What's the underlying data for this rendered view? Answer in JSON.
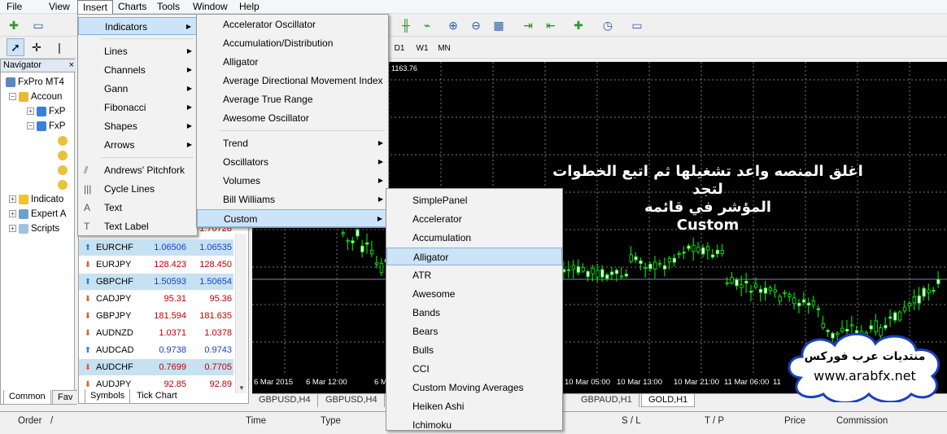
{
  "menubar": {
    "items": [
      "File",
      "View",
      "Insert",
      "Charts",
      "Tools",
      "Window",
      "Help"
    ],
    "active": "Insert"
  },
  "toolbar": {
    "timeframes": [
      "D1",
      "W1",
      "MN"
    ]
  },
  "navigator": {
    "title": "Navigator",
    "tree": [
      {
        "label": "FxPro MT4",
        "icon": "terminal-icon"
      },
      {
        "label": "Accoun",
        "icon": "accounts-icon"
      },
      {
        "label": "FxP",
        "icon": "server-icon"
      },
      {
        "label": "FxP",
        "icon": "server-icon"
      },
      {
        "label": "",
        "icon": "user-icon"
      },
      {
        "label": "",
        "icon": "user-icon"
      },
      {
        "label": "",
        "icon": "user-icon"
      },
      {
        "label": "",
        "icon": "user-icon"
      },
      {
        "label": "Indicato",
        "icon": "indicators-icon"
      },
      {
        "label": "Expert A",
        "icon": "expert-icon"
      },
      {
        "label": "Scripts",
        "icon": "scripts-icon"
      }
    ],
    "tabs": [
      "Common",
      "Fav"
    ]
  },
  "market_watch": {
    "partial_top": "1.70728",
    "rows": [
      {
        "symbol": "EURCHF",
        "bid": "1.06506",
        "ask": "1.06535",
        "dir": "up",
        "highlight": true
      },
      {
        "symbol": "EURJPY",
        "bid": "128.423",
        "ask": "128.450",
        "dir": "down",
        "highlight": false
      },
      {
        "symbol": "GBPCHF",
        "bid": "1.50593",
        "ask": "1.50654",
        "dir": "up",
        "highlight": true
      },
      {
        "symbol": "CADJPY",
        "bid": "95.31",
        "ask": "95.36",
        "dir": "down",
        "highlight": false
      },
      {
        "symbol": "GBPJPY",
        "bid": "181.594",
        "ask": "181.635",
        "dir": "down",
        "highlight": false
      },
      {
        "symbol": "AUDNZD",
        "bid": "1.0371",
        "ask": "1.0378",
        "dir": "down",
        "highlight": false
      },
      {
        "symbol": "AUDCAD",
        "bid": "0.9738",
        "ask": "0.9743",
        "dir": "up",
        "highlight": false
      },
      {
        "symbol": "AUDCHF",
        "bid": "0.7699",
        "ask": "0.7705",
        "dir": "down",
        "highlight": true
      },
      {
        "symbol": "AUDJPY",
        "bid": "92.85",
        "ask": "92.89",
        "dir": "down",
        "highlight": false
      }
    ],
    "tabs": [
      "Symbols",
      "Tick Chart"
    ]
  },
  "chart": {
    "price_label": "1163.76",
    "time_labels": [
      "6 Mar 2015",
      "6 Mar 12:00",
      "6 Mar 20",
      "10 Mar 05:00",
      "10 Mar 13:00",
      "10 Mar 21:00",
      "11 Mar 06:00",
      "11"
    ],
    "bull_color": "#00ff00",
    "bear_color": "#ffffff",
    "annotation_line1": "اغلق المنصه واعد تشغيلها ثم اتبع الخطوات لتجد",
    "annotation_line2": "المؤشر في قائمه",
    "annotation_line3": "Custom",
    "tabs": [
      "GBPUSD,H4",
      "GBPUSD,H4",
      "GBPAUD,H1",
      "GOLD,H1"
    ],
    "active_tab": "GOLD,H1"
  },
  "watermark": {
    "line1": "منتديات عرب فوركس",
    "line2": "www.arabfx.net"
  },
  "insert_menu": {
    "items": [
      {
        "label": "Indicators",
        "sub": true,
        "icon": ""
      },
      {
        "label": "Lines",
        "sub": true,
        "icon": ""
      },
      {
        "label": "Channels",
        "sub": true,
        "icon": ""
      },
      {
        "label": "Gann",
        "sub": true,
        "icon": ""
      },
      {
        "label": "Fibonacci",
        "sub": true,
        "icon": ""
      },
      {
        "label": "Shapes",
        "sub": true,
        "icon": ""
      },
      {
        "label": "Arrows",
        "sub": true,
        "icon": ""
      },
      {
        "label": "Andrews' Pitchfork",
        "sub": false,
        "icon": "⫽"
      },
      {
        "label": "Cycle Lines",
        "sub": false,
        "icon": "|||"
      },
      {
        "label": "Text",
        "sub": false,
        "icon": "A"
      },
      {
        "label": "Text Label",
        "sub": false,
        "icon": "T"
      }
    ]
  },
  "indicators_menu": {
    "items": [
      {
        "label": "Accelerator Oscillator",
        "sub": false
      },
      {
        "label": "Accumulation/Distribution",
        "sub": false
      },
      {
        "label": "Alligator",
        "sub": false
      },
      {
        "label": "Average Directional Movement Index",
        "sub": false
      },
      {
        "label": "Average True Range",
        "sub": false
      },
      {
        "label": "Awesome Oscillator",
        "sub": false
      },
      {
        "label": "Trend",
        "sub": true
      },
      {
        "label": "Oscillators",
        "sub": true
      },
      {
        "label": "Volumes",
        "sub": true
      },
      {
        "label": "Bill Williams",
        "sub": true
      },
      {
        "label": "Custom",
        "sub": true
      }
    ]
  },
  "custom_menu": {
    "items": [
      "SimplePanel",
      "Accelerator",
      "Accumulation",
      "Alligator",
      "ATR",
      "Awesome",
      "Bands",
      "Bears",
      "Bulls",
      "CCI",
      "Custom Moving Averages",
      "Heiken Ashi",
      "Ichimoku"
    ],
    "highlighted": "Alligator"
  },
  "terminal": {
    "columns": [
      "Order",
      "/",
      "Time",
      "Type",
      "S / L",
      "T / P",
      "Price",
      "Commission"
    ]
  }
}
